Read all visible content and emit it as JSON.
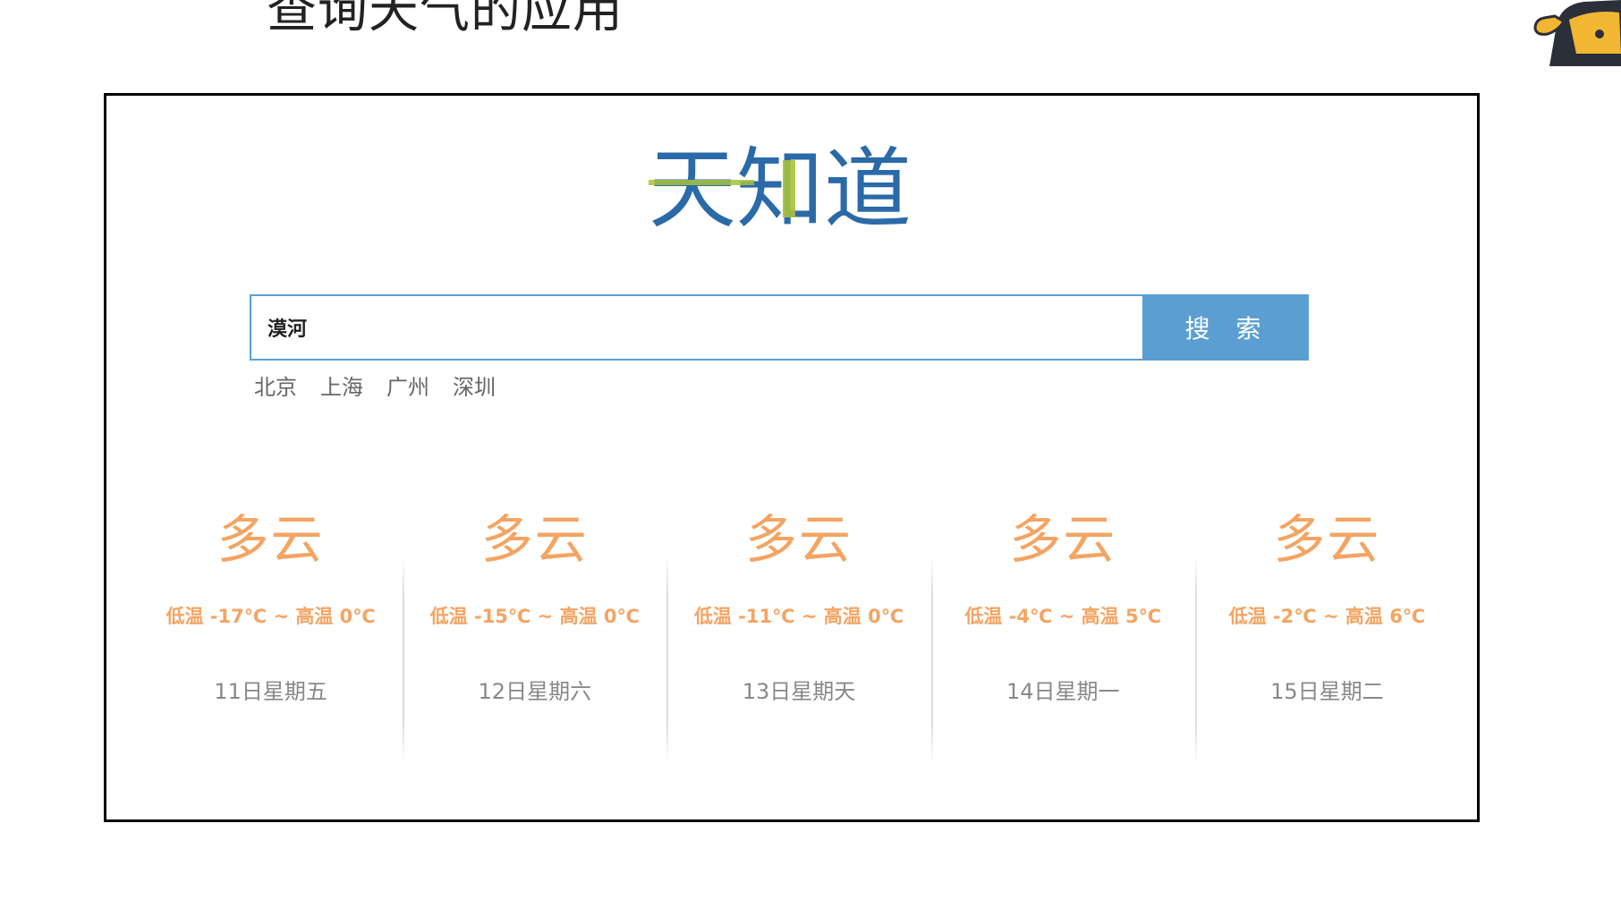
{
  "slide": {
    "title": "查询天气的应用"
  },
  "app": {
    "logo_text": "天知道",
    "colors": {
      "logo_blue": "#2a6aa8",
      "logo_green": "#a8c23a",
      "button_blue": "#5b9fd2",
      "weather_orange": "#f4a462"
    },
    "search": {
      "value": "漠河",
      "placeholder": "",
      "button_label": "搜 索"
    },
    "quick_links": [
      "北京",
      "上海",
      "广州",
      "深圳"
    ],
    "forecast": [
      {
        "weather": "多云",
        "temp": "低温 -17℃ ~ 高温 0℃",
        "date": "11日星期五"
      },
      {
        "weather": "多云",
        "temp": "低温 -15℃ ~ 高温 0℃",
        "date": "12日星期六"
      },
      {
        "weather": "多云",
        "temp": "低温 -11℃ ~ 高温 0℃",
        "date": "13日星期天"
      },
      {
        "weather": "多云",
        "temp": "低温 -4℃ ~ 高温 5℃",
        "date": "14日星期一"
      },
      {
        "weather": "多云",
        "temp": "低温 -2℃ ~ 高温 6℃",
        "date": "15日星期二"
      }
    ]
  }
}
